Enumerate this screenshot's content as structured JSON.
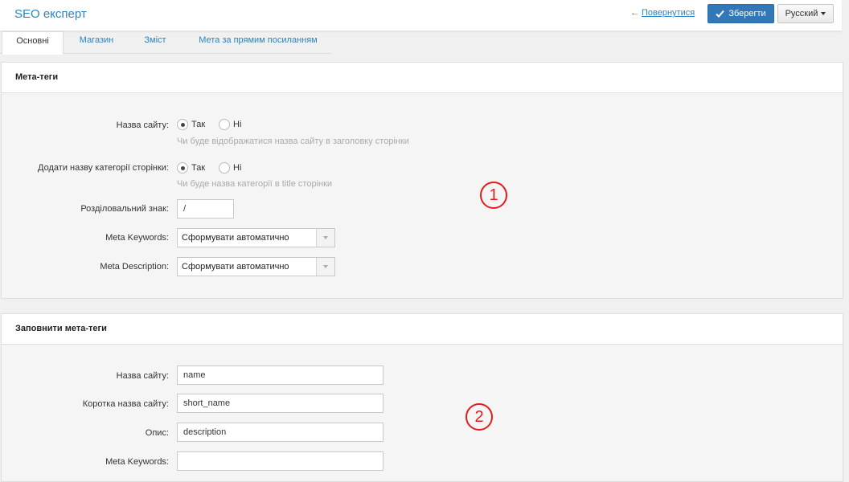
{
  "header": {
    "title": "SEO експерт",
    "back_label": "Повернутися",
    "save_label": "Зберегти",
    "language": "Русский"
  },
  "tabs": [
    {
      "label": "Основні",
      "active": true
    },
    {
      "label": "Магазин",
      "active": false
    },
    {
      "label": "Зміст",
      "active": false
    },
    {
      "label": "Мета за прямим посиланням",
      "active": false
    }
  ],
  "meta_tags": {
    "title": "Мета-теги",
    "site_name": {
      "label": "Назва сайту:",
      "options": [
        "Так",
        "Ні"
      ],
      "selected": "Так",
      "hint": "Чи буде відображатися назва сайту в заголовку сторінки"
    },
    "category_name": {
      "label": "Додати назву категорії сторінки:",
      "options": [
        "Так",
        "Ні"
      ],
      "selected": "Так",
      "hint": "Чи буде назва категорії в title сторінки"
    },
    "separator": {
      "label": "Розділовальний знак:",
      "value": "/"
    },
    "meta_keywords": {
      "label": "Meta Keywords:",
      "value": "Сформувати автоматично"
    },
    "meta_description": {
      "label": "Meta Description:",
      "value": "Сформувати автоматично"
    }
  },
  "fill_meta": {
    "title": "Заповнити мета-теги",
    "site_name": {
      "label": "Назва сайту:",
      "value": "name"
    },
    "short_name": {
      "label": "Коротка назва сайту:",
      "value": "short_name"
    },
    "description": {
      "label": "Опис:",
      "value": "description"
    },
    "meta_keywords": {
      "label": "Meta Keywords:",
      "value": ""
    }
  },
  "markers": [
    "1",
    "2"
  ],
  "colors": {
    "accent": "#2a84c2",
    "primary_button": "#3278b8",
    "marker": "#e21b1b"
  }
}
